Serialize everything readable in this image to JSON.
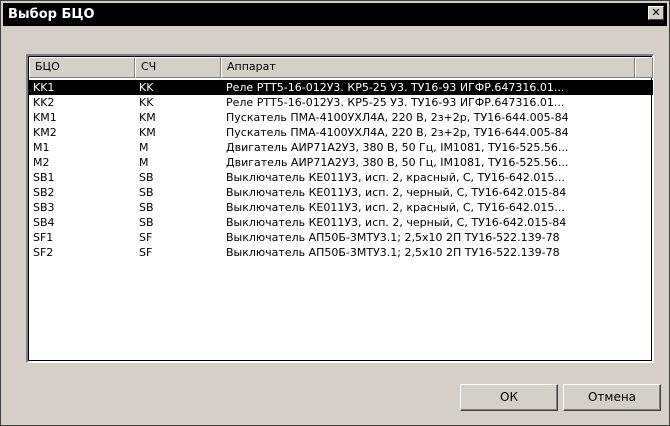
{
  "window": {
    "title": "Выбор БЦО",
    "close_glyph": "✕"
  },
  "table": {
    "columns": [
      "БЦО",
      "СЧ",
      "Аппарат"
    ],
    "rows": [
      {
        "bco": "KK1",
        "sch": "KK",
        "device": "Реле РТТ5-16-012У3. КР5-25 У3. ТУ16-93 ИГФР.647316.01...",
        "selected": true
      },
      {
        "bco": "KK2",
        "sch": "KK",
        "device": "Реле РТТ5-16-012У3. КР5-25 У3. ТУ16-93 ИГФР.647316.01...",
        "selected": false
      },
      {
        "bco": "KM1",
        "sch": "KM",
        "device": "Пускатель ПМА-4100УХЛ4А, 220 В, 2з+2р, ТУ16-644.005-84",
        "selected": false
      },
      {
        "bco": "KM2",
        "sch": "KM",
        "device": "Пускатель ПМА-4100УХЛ4А, 220 В, 2з+2р, ТУ16-644.005-84",
        "selected": false
      },
      {
        "bco": "M1",
        "sch": "M",
        "device": "Двигатель АИР71А2У3, 380 В, 50 Гц, IM1081, ТУ16-525.56...",
        "selected": false
      },
      {
        "bco": "M2",
        "sch": "M",
        "device": "Двигатель АИР71А2У3, 380 В, 50 Гц, IM1081, ТУ16-525.56...",
        "selected": false
      },
      {
        "bco": "SB1",
        "sch": "SB",
        "device": "Выключатель КЕ011У3, исп. 2, красный, С, ТУ16-642.015...",
        "selected": false
      },
      {
        "bco": "SB2",
        "sch": "SB",
        "device": "Выключатель КЕ011У3, исп. 2, черный, С, ТУ16-642.015-84",
        "selected": false
      },
      {
        "bco": "SB3",
        "sch": "SB",
        "device": "Выключатель КЕ011У3, исп. 2, красный, С, ТУ16-642.015...",
        "selected": false
      },
      {
        "bco": "SB4",
        "sch": "SB",
        "device": "Выключатель КЕ011У3, исп. 2, черный, С, ТУ16-642.015-84",
        "selected": false
      },
      {
        "bco": "SF1",
        "sch": "SF",
        "device": "Выключатель АП50Б-3МТУ3.1; 2,5х10 2П ТУ16-522.139-78",
        "selected": false
      },
      {
        "bco": "SF2",
        "sch": "SF",
        "device": "Выключатель АП50Б-3МТУ3.1; 2,5х10 2П ТУ16-522.139-78",
        "selected": false
      }
    ]
  },
  "buttons": {
    "ok": "ОК",
    "cancel": "Отмена"
  },
  "colors": {
    "face": "#d4d0c8",
    "selection_bg": "#000000",
    "selection_fg": "#ffffff"
  }
}
